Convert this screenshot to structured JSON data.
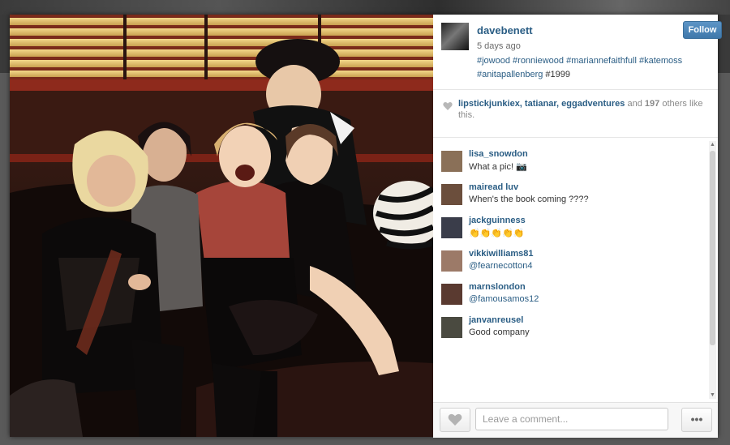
{
  "post": {
    "username": "davebenett",
    "time_ago": "5 days ago",
    "hashtags": "#jowood #ronniewood #mariannefaithfull #katemoss",
    "hashtags_line2": "#anitapallenberg",
    "caption_plain": "#1999",
    "follow_label": "Follow"
  },
  "likes": {
    "users": "lipstickjunkiex, tatianar, eggadventures",
    "and_text": "and",
    "count": "197",
    "others_text": "others like this."
  },
  "comments": [
    {
      "user": "lisa_snowdon",
      "text": "What a pic! 📷",
      "avatar_color": "#8a7058"
    },
    {
      "user": "mairead luv",
      "text": "When's the book coming ????",
      "avatar_color": "#6b4e3c"
    },
    {
      "user": "jackguinness",
      "text": "👏👏👏👏👏",
      "avatar_color": "#3a3d4a"
    },
    {
      "user": "vikkiwilliams81",
      "text": "@fearnecotton4",
      "avatar_color": "#9c7a68"
    },
    {
      "user": "marnslondon",
      "text": "@famousamos12",
      "avatar_color": "#5a3a30"
    },
    {
      "user": "janvanreusel",
      "text": "Good company",
      "avatar_color": "#4a4a40"
    }
  ],
  "footer": {
    "comment_placeholder": "Leave a comment...",
    "more_label": "•••"
  },
  "icons": {
    "like": "heart-icon",
    "more": "ellipsis-icon"
  },
  "colors": {
    "link": "#2a5d84",
    "follow": "#4a84b8"
  }
}
